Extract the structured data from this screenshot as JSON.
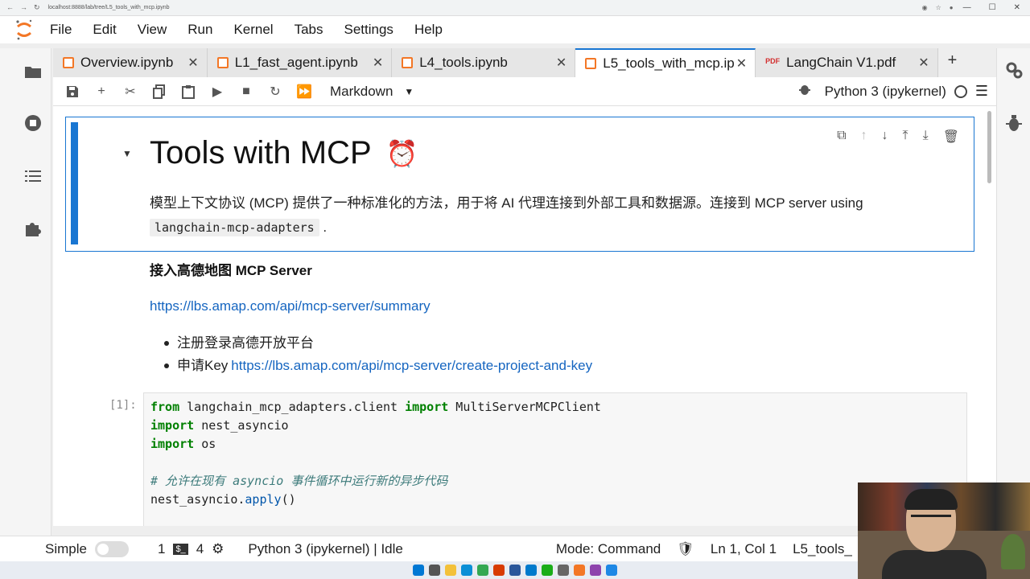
{
  "browser": {
    "url": "localhost:8888/lab/tree/L5_tools_with_mcp.ipynb"
  },
  "menubar": {
    "items": [
      "File",
      "Edit",
      "View",
      "Run",
      "Kernel",
      "Tabs",
      "Settings",
      "Help"
    ]
  },
  "tabs": [
    {
      "label": "Overview.ipynb",
      "type": "notebook",
      "active": false
    },
    {
      "label": "L1_fast_agent.ipynb",
      "type": "notebook",
      "active": false
    },
    {
      "label": "L4_tools.ipynb",
      "type": "notebook",
      "active": false
    },
    {
      "label": "L5_tools_with_mcp.ip",
      "type": "notebook",
      "active": true
    },
    {
      "label": "LangChain V1.pdf",
      "type": "pdf",
      "active": false
    }
  ],
  "toolbar": {
    "cell_type": "Markdown",
    "kernel": "Python 3 (ipykernel)"
  },
  "cell1": {
    "title": "Tools with MCP",
    "title_emoji": "⏰",
    "paragraph": "模型上下文协议 (MCP) 提供了一种标准化的方法，用于将 AI 代理连接到外部工具和数据源。连接到 MCP server using",
    "code_inline": "langchain-mcp-adapters",
    "paragraph_end": "."
  },
  "cell2": {
    "heading": "接入高德地图 MCP Server",
    "link": "https://lbs.amap.com/api/mcp-server/summary",
    "bullets": [
      {
        "text": "注册登录高德开放平台",
        "link": ""
      },
      {
        "text": "申请Key",
        "link": "https://lbs.amap.com/api/mcp-server/create-project-and-key"
      }
    ]
  },
  "code_cell": {
    "prompt": "[1]:",
    "line1_kw1": "from",
    "line1_mod": " langchain_mcp_adapters.client ",
    "line1_kw2": "import",
    "line1_name": " MultiServerMCPClient",
    "line2_kw": "import",
    "line2_name": " nest_asyncio",
    "line3_kw": "import",
    "line3_name": " os",
    "comment": "# 允许在现有 asyncio 事件循环中运行新的异步代码",
    "line5_obj": "nest_asyncio.",
    "line5_fn": "apply",
    "line5_end": "()"
  },
  "statusbar": {
    "mode_label": "Simple",
    "count1": "1",
    "count2": "4",
    "kernel_status": "Python 3 (ipykernel) | Idle",
    "mode": "Mode: Command",
    "position": "Ln 1, Col 1",
    "file": "L5_tools_"
  },
  "colors": {
    "accent": "#1976d2",
    "link": "#1565c0",
    "jupyter_orange": "#f37726"
  }
}
